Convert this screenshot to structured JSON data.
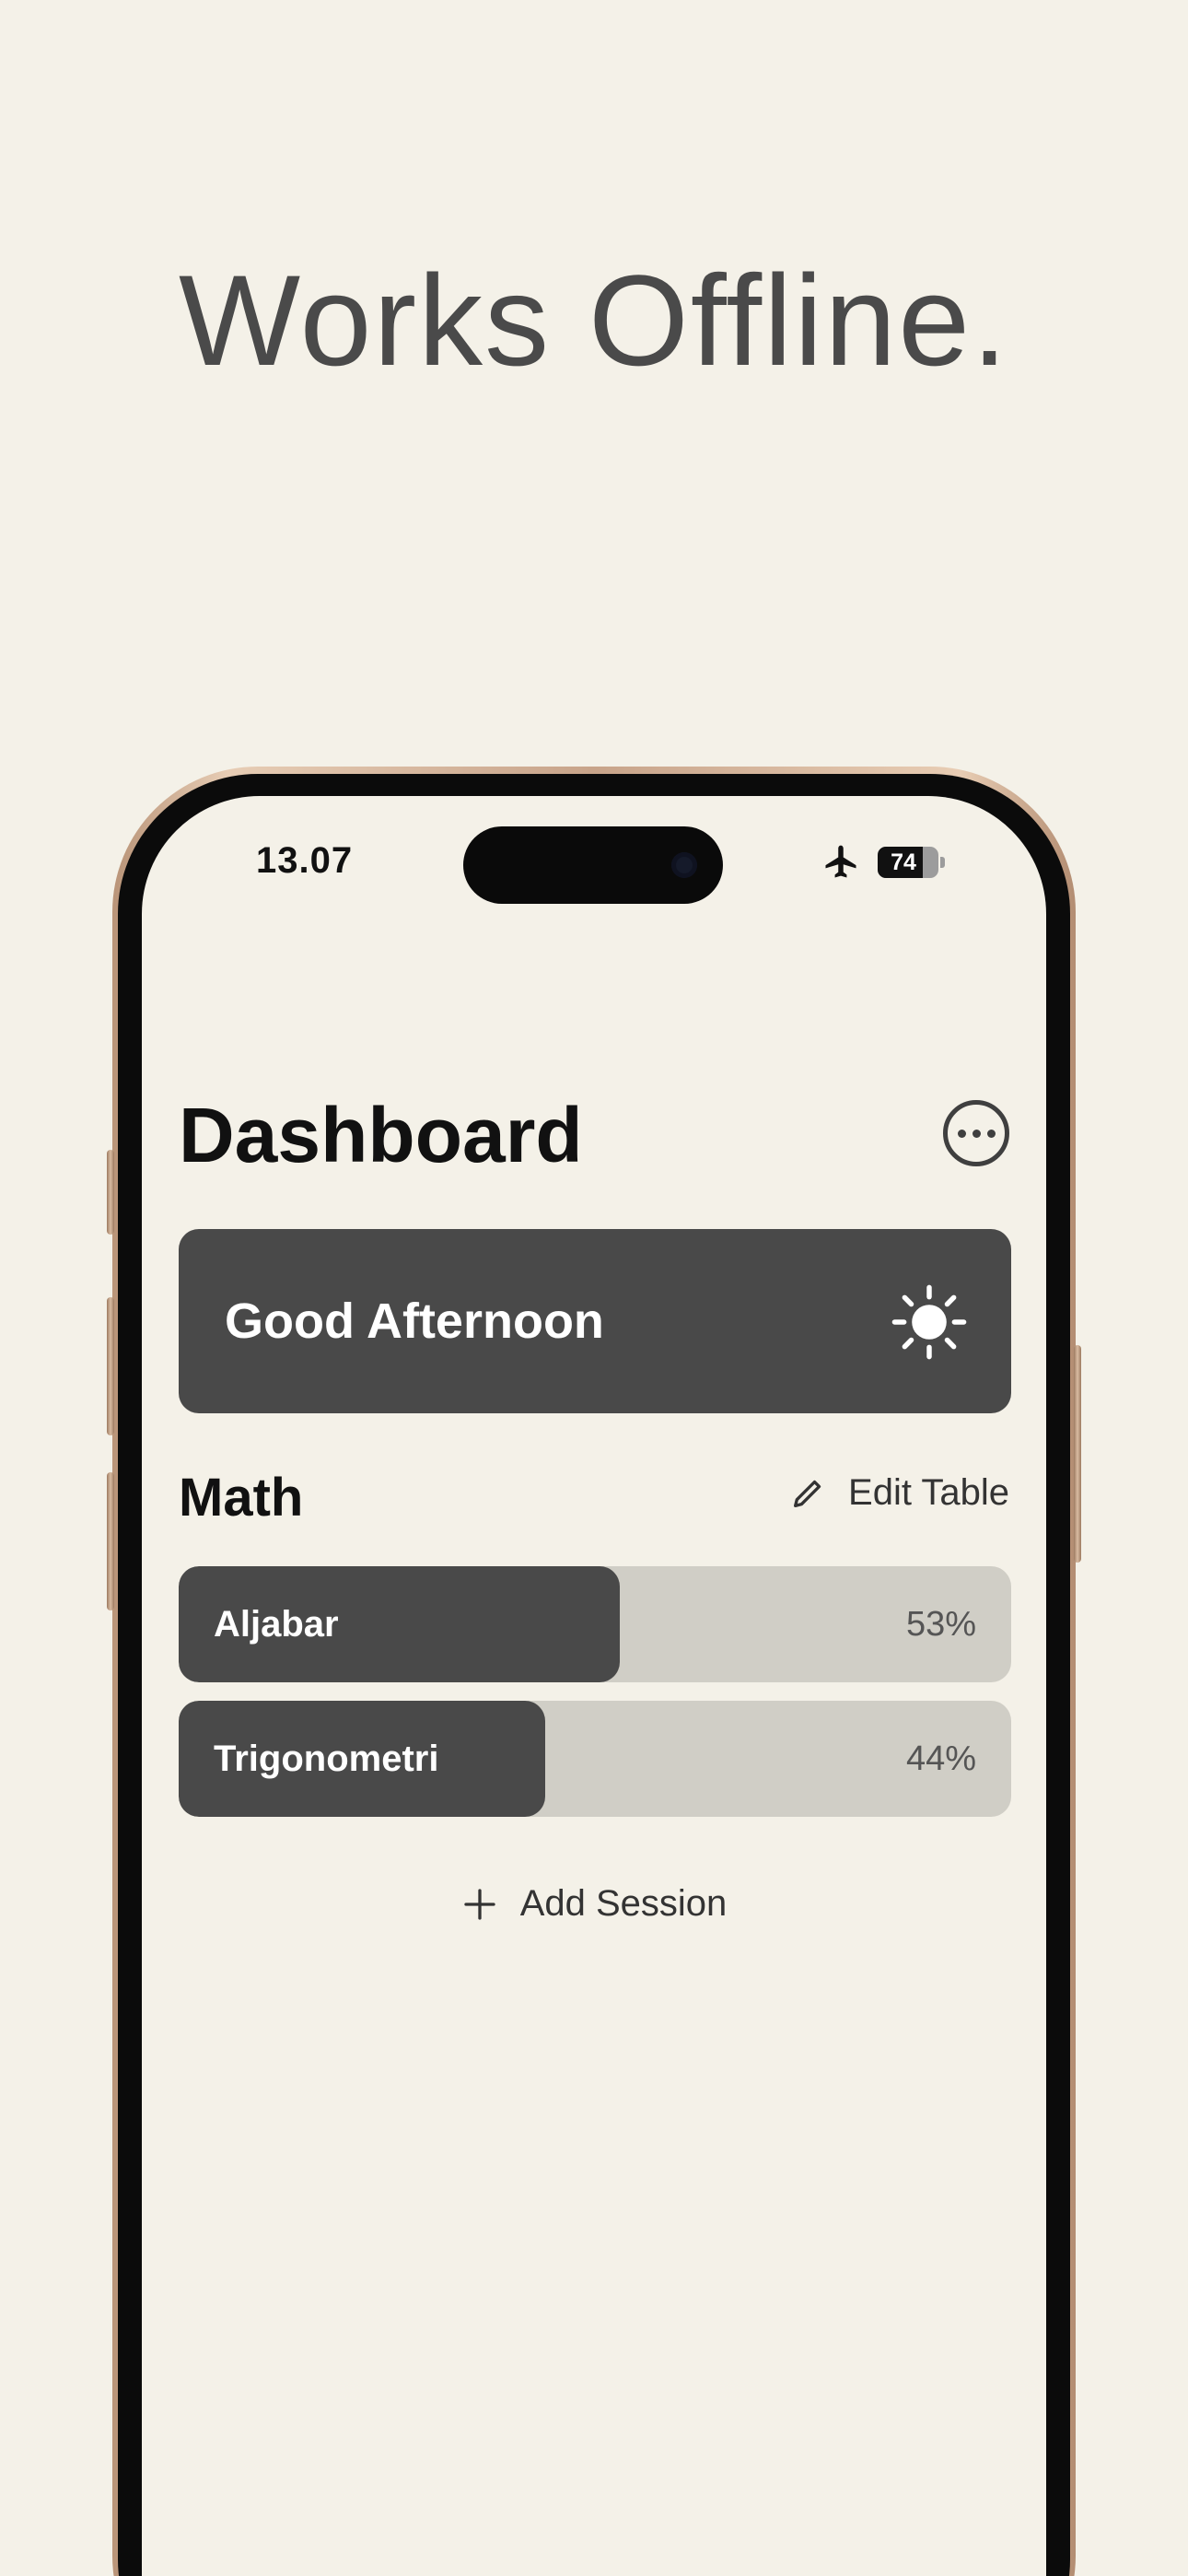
{
  "headline": "Works Offline.",
  "status_bar": {
    "time": "13.07",
    "airplane_icon": "airplane-icon",
    "battery_level": "74",
    "battery_fraction": 0.74
  },
  "dashboard": {
    "title": "Dashboard",
    "more_icon": "ellipsis-circle-icon",
    "greeting": "Good Afternoon",
    "greeting_icon": "sun-icon"
  },
  "section": {
    "title": "Math",
    "edit_label": "Edit Table",
    "edit_icon": "pencil-icon"
  },
  "sessions": [
    {
      "name": "Aljabar",
      "percent_label": "53%",
      "progress": 0.53
    },
    {
      "name": "Trigonometri",
      "percent_label": "44%",
      "progress": 0.44
    }
  ],
  "add_session": {
    "label": "Add Session",
    "icon": "plus-icon"
  },
  "colors": {
    "background": "#f4f1e8",
    "card_dark": "#494949",
    "track": "#d0cec6",
    "text_dark": "#111111"
  }
}
